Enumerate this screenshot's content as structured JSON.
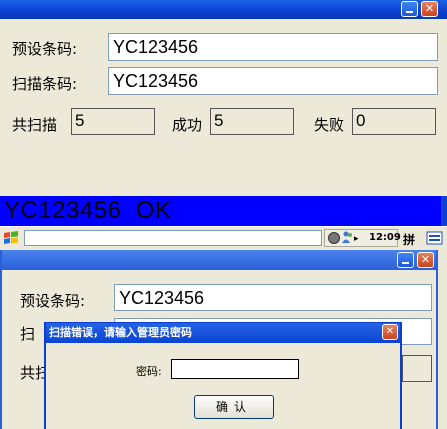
{
  "main": {
    "preset_label": "预设条码:",
    "preset_value": "YC123456",
    "scan_label": "扫描条码:",
    "scan_value": "YC123456",
    "total_label": "共扫描",
    "total_value": "5",
    "success_label": "成功",
    "success_value": "5",
    "fail_label": "失败",
    "fail_value": "0",
    "status_message": "YC123456  OK",
    "status_color": "#0000ff"
  },
  "taskbar": {
    "start_icon": "windows-flag-icon",
    "clock": "12:09",
    "ime": "拼",
    "tray_icons": [
      "network-globe-icon",
      "people-icon",
      "arrow-right-icon"
    ],
    "right_icon": "keyboard-icon"
  },
  "second": {
    "preset_label": "预设条码:",
    "preset_value": "YC123456",
    "scan_label_partial": "扫",
    "total_label_partial": "共扫"
  },
  "dialog": {
    "title": "扫描错误，请输入管理员密码",
    "password_label": "密码:",
    "password_value": "",
    "ok_label": "确认"
  },
  "colors": {
    "titlebar": "#0a3fd0",
    "close": "#c94320",
    "window_bg": "#ece9d8"
  }
}
